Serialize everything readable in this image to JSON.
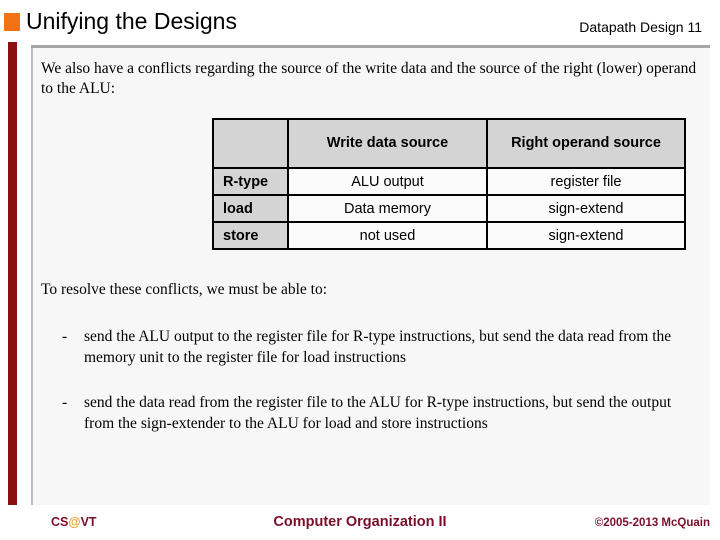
{
  "header": {
    "title": "Unifying the Designs",
    "right_label": "Datapath Design  11",
    "accent_color": "#f47216"
  },
  "content": {
    "intro_text": "We also have a conflicts regarding the source of the write data and the source of the right (lower) operand to the ALU:",
    "resolve_text": "To resolve these conflicts, we must be able to:",
    "bullets": [
      {
        "marker": "-",
        "text": "send the ALU output to the register file for R-type instructions, but send the data read from the memory unit to the register file for load instructions"
      },
      {
        "marker": "-",
        "text": "send the data read from the register file to the ALU for R-type instructions, but send the output from the sign-extender to the ALU for load and store instructions"
      }
    ]
  },
  "table": {
    "headers": [
      "",
      "Write data source",
      "Right operand source"
    ],
    "rows": [
      {
        "label": "R-type",
        "write_data_source": "ALU output",
        "right_operand_source": "register file"
      },
      {
        "label": "load",
        "write_data_source": "Data memory",
        "right_operand_source": "sign-extend"
      },
      {
        "label": "store",
        "write_data_source": "not used",
        "right_operand_source": "sign-extend"
      }
    ]
  },
  "footer": {
    "left_prefix": "CS",
    "left_at": "@",
    "left_suffix": "VT",
    "center": "Computer Organization II",
    "right": "©2005-2013 McQuain",
    "color": "#7b0f2b"
  }
}
